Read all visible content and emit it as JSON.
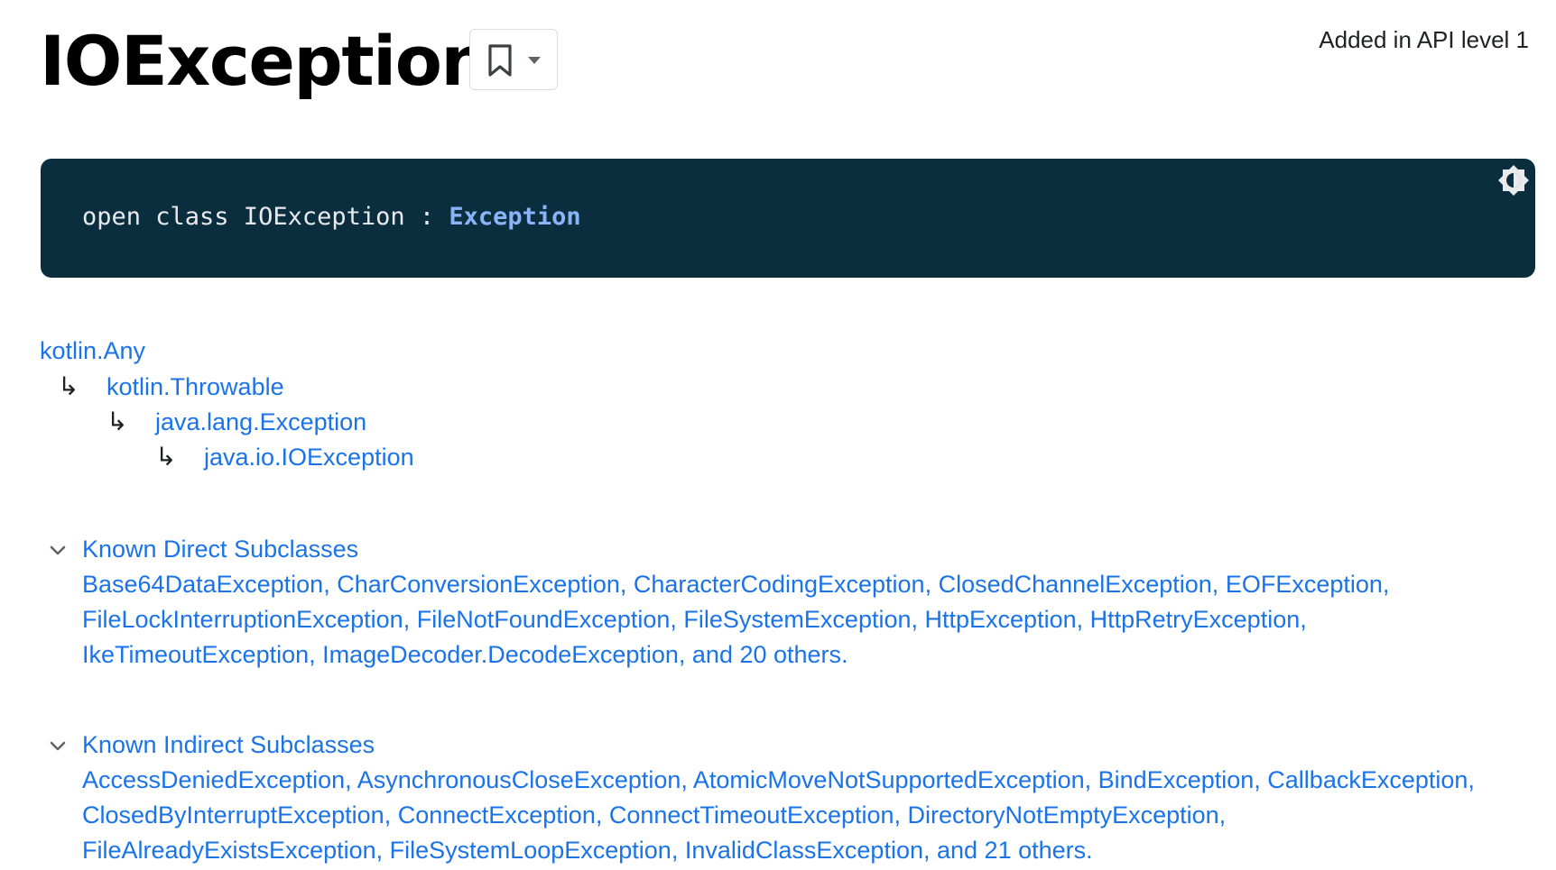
{
  "header": {
    "title": "IOException",
    "api_level": "Added in API level 1",
    "bookmark_icon": "bookmark-icon",
    "dropdown_icon": "caret-down-icon"
  },
  "signature": {
    "keywords": "open class IOException : ",
    "parent_link": "Exception",
    "theme_toggle_icon": "brightness-icon",
    "background_color": "#0b2e3f",
    "link_color": "#8ab4f8"
  },
  "inheritance": {
    "items": [
      "kotlin.Any",
      "kotlin.Throwable",
      "java.lang.Exception",
      "java.io.IOException"
    ],
    "arrow_glyph": "↳"
  },
  "direct_subclasses": {
    "title": "Known Direct Subclasses",
    "items": [
      "Base64DataException",
      "CharConversionException",
      "CharacterCodingException",
      "ClosedChannelException",
      "EOFException",
      "FileLockInterruptionException",
      "FileNotFoundException",
      "FileSystemException",
      "HttpException",
      "HttpRetryException",
      "IkeTimeoutException",
      "ImageDecoder.DecodeException"
    ],
    "more": "and 20 others."
  },
  "indirect_subclasses": {
    "title": "Known Indirect Subclasses",
    "items": [
      "AccessDeniedException",
      "AsynchronousCloseException",
      "AtomicMoveNotSupportedException",
      "BindException",
      "CallbackException",
      "ClosedByInterruptException",
      "ConnectException",
      "ConnectTimeoutException",
      "DirectoryNotEmptyException",
      "FileAlreadyExistsException",
      "FileSystemLoopException",
      "InvalidClassException"
    ],
    "more": "and 21 others."
  },
  "colors": {
    "link": "#1a73e8",
    "text": "#202124"
  }
}
